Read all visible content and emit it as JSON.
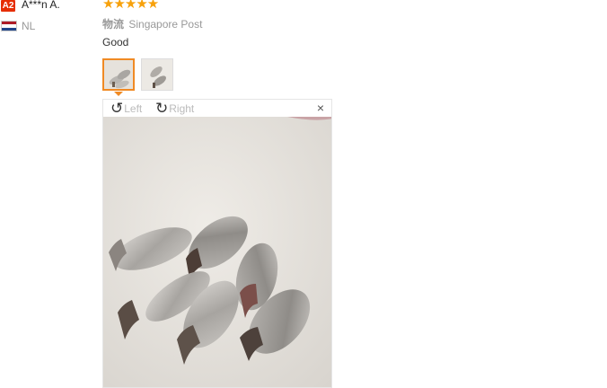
{
  "reviewer": {
    "badge": "A2",
    "name": "A***n A.",
    "country": "NL"
  },
  "rating": {
    "stars": "★★★★★",
    "value": 5
  },
  "logistics": {
    "label": "物流",
    "carrier": "Singapore Post"
  },
  "review": {
    "text": "Good"
  },
  "viewer": {
    "rotate_left_label": "Left",
    "rotate_right_label": "Right",
    "rotate_left_icon": "↺",
    "rotate_right_icon": "↻",
    "close_icon": "×"
  },
  "colors": {
    "badge": "#e62e04",
    "stars": "#f7a10b",
    "active_thumb": "#f08a24"
  }
}
